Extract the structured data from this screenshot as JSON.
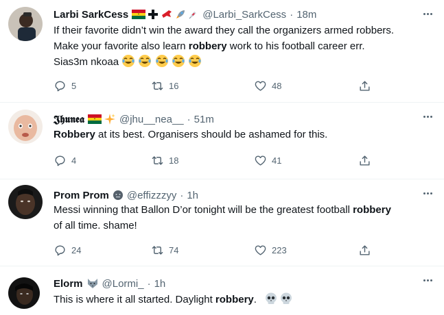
{
  "tweets": [
    {
      "name": "Larbi SarkCess",
      "handle": "@Larbi_SarkCess",
      "dot": "·",
      "time": "18m",
      "text_parts": [
        "If their favorite didn’t win the award they call the organizers armed robbers.",
        "Make your favorite also learn ",
        "robbery",
        " work to his football career err.",
        "Sias3m nkoaa"
      ],
      "badge_icons": [
        "ghana-flag-icon",
        "cross-icon",
        "bird-icon",
        "rocket-icon",
        "syringe-icon"
      ],
      "emoji_icons": [
        "joy-emoji-icon",
        "joy-emoji-icon",
        "joy-emoji-icon",
        "joy-emoji-icon",
        "joy-emoji-icon"
      ],
      "replies": "5",
      "retweets": "16",
      "likes": "48"
    },
    {
      "name": "𝕵𝖍𝖚𝖓𝖊𝖆",
      "handle": "@jhu__nea__",
      "dot": "·",
      "time": "51m",
      "text_parts": [
        "Robbery",
        " at its best. Organisers should be ashamed for this."
      ],
      "badge_icons": [
        "ghana-flag-icon",
        "sparkles-icon"
      ],
      "replies": "4",
      "retweets": "18",
      "likes": "41"
    },
    {
      "name": "Prom Prom",
      "handle": "@effizzzyy",
      "dot": "·",
      "time": "1h",
      "text_parts": [
        "Messi winning that Ballon D’or tonight will be the greatest football ",
        "robbery",
        "of all time. shame!"
      ],
      "badge_icons": [
        "blue-circle-icon"
      ],
      "replies": "24",
      "retweets": "74",
      "likes": "223"
    },
    {
      "name": "Elorm",
      "handle": "@Lormi_",
      "dot": "·",
      "time": "1h",
      "text_parts": [
        "This is where it all started. Daylight ",
        "robbery",
        "."
      ],
      "badge_icons": [
        "wolf-icon"
      ],
      "emoji_icons": [
        "skull-emoji-icon",
        "skull-emoji-icon"
      ]
    }
  ],
  "colors": {
    "text": "#0f1419",
    "secondary": "#536471",
    "divider": "#eff3f4",
    "emoji": "#ffcc4d"
  }
}
